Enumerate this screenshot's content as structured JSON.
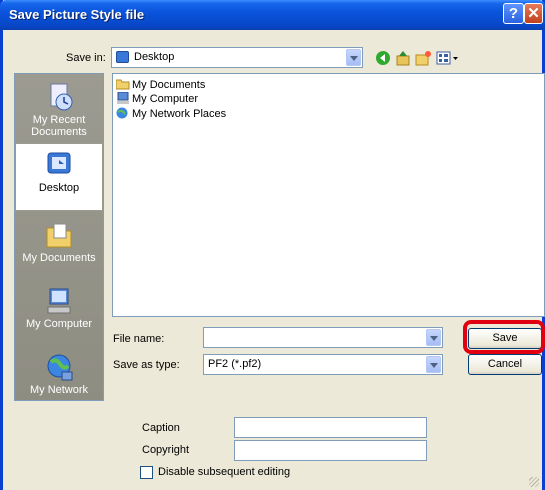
{
  "window": {
    "title": "Save Picture Style file",
    "help": "?",
    "close": "✕"
  },
  "toolbar": {
    "save_in_label": "Save in:",
    "save_in_value": "Desktop"
  },
  "places": [
    {
      "label_lines": [
        "My Recent",
        "Documents"
      ],
      "icon": "recent-documents-icon"
    },
    {
      "label_lines": [
        "Desktop"
      ],
      "icon": "desktop-icon"
    },
    {
      "label_lines": [
        "My Documents"
      ],
      "icon": "my-documents-icon"
    },
    {
      "label_lines": [
        "My Computer"
      ],
      "icon": "my-computer-icon"
    },
    {
      "label_lines": [
        "My Network"
      ],
      "icon": "my-network-icon"
    }
  ],
  "files": [
    {
      "name": "My Documents",
      "icon": "my-documents-icon"
    },
    {
      "name": "My Computer",
      "icon": "my-computer-icon"
    },
    {
      "name": "My Network Places",
      "icon": "network-places-icon"
    }
  ],
  "form": {
    "file_name_label": "File name:",
    "file_name_value": "",
    "save_as_type_label": "Save as type:",
    "save_as_type_value": "PF2 (*.pf2)",
    "save_button": "Save",
    "cancel_button": "Cancel"
  },
  "extra": {
    "caption_label": "Caption",
    "caption_value": "",
    "copyright_label": "Copyright",
    "copyright_value": "",
    "disable_label": "Disable subsequent editing",
    "disable_checked": false
  },
  "colors": {
    "titlebar": "#0a54dc",
    "highlight": "#e00010",
    "background": "#ece9d8"
  }
}
